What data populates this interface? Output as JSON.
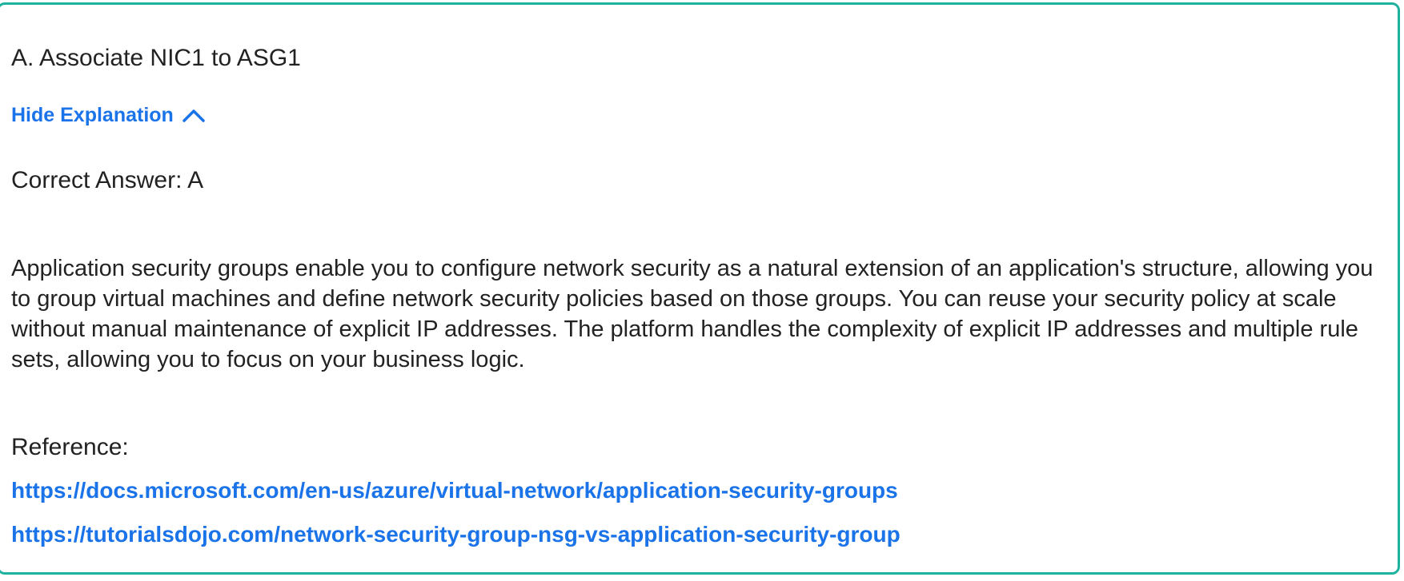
{
  "answer_option": "A. Associate NIC1 to ASG1",
  "toggle": {
    "label": "Hide Explanation",
    "icon": "chevron-up-icon",
    "color": "#1a73e8"
  },
  "correct_answer": "Correct Answer: A",
  "explanation": "Application security groups enable you to configure network security as a natural extension of an application's structure, allowing you to group virtual machines and define network security policies based on those groups. You can reuse your security policy at scale without manual maintenance of explicit IP addresses. The platform handles the complexity of explicit IP addresses and multiple rule sets, allowing you to focus on your business logic.",
  "reference": {
    "label": "Reference:",
    "links": [
      "https://docs.microsoft.com/en-us/azure/virtual-network/application-security-groups",
      "https://tutorialsdojo.com/network-security-group-nsg-vs-application-security-group"
    ]
  },
  "colors": {
    "border": "#1fb39f",
    "link": "#1a73e8",
    "text": "#222222"
  }
}
